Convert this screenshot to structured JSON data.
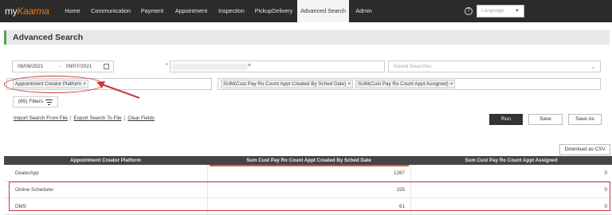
{
  "navbar": {
    "logo_prefix": "my",
    "logo_accent": "Kaarma",
    "items": [
      {
        "label": "Home"
      },
      {
        "label": "Communication"
      },
      {
        "label": "Payment"
      },
      {
        "label": "Appointment"
      },
      {
        "label": "Inspection"
      },
      {
        "label": "PickupDelivery"
      },
      {
        "label": "Advanced Search",
        "active": true
      },
      {
        "label": "Admin"
      }
    ],
    "help_glyph": "?",
    "language_placeholder": "Language"
  },
  "page": {
    "title": "Advanced Search"
  },
  "filters": {
    "date_start": "08/08/2021",
    "date_arrow": "→",
    "date_end": "09/07/2021",
    "dealer_required_mark": "*",
    "dealer_clear": "×",
    "saved_searches_placeholder": "Saved Searches",
    "group_by_chip": "Appointment Creator Platform",
    "chip_remove": "×",
    "measure_chips": [
      "SUM(Cust Pay Ro Count Appt Created By Sched Date)",
      "SUM(Cust Pay Ro Count Appt Assigned)"
    ],
    "filters_button": "(65) Filters"
  },
  "links": {
    "import": "Import Search From File",
    "separator": "|",
    "export": "Export Search To File",
    "clear": "Clear Fields"
  },
  "actions": {
    "run": "Run",
    "save": "Save",
    "save_as": "Save As",
    "download_csv": "Download as CSV"
  },
  "table": {
    "columns": [
      "Appointment Creator Platform",
      "Sum Cust Pay Ro Count Appt Created By Sched Date",
      "Sum Cust Pay Ro Count Appt Assigned"
    ],
    "rows": [
      {
        "platform": "DealerApp",
        "created": "1267",
        "assigned": "0"
      },
      {
        "platform": "Online Scheduler",
        "created": "155",
        "assigned": "0"
      },
      {
        "platform": "DMS",
        "created": "61",
        "assigned": "0"
      }
    ]
  },
  "colors": {
    "accent": "#5aa05a",
    "annotation": "#c83a3a",
    "sort_indicator": "#d8612f",
    "navbar": "#2b2b2b"
  },
  "icons": [
    "help-icon",
    "calendar-icon",
    "chevron-down-icon",
    "filter-icon"
  ]
}
